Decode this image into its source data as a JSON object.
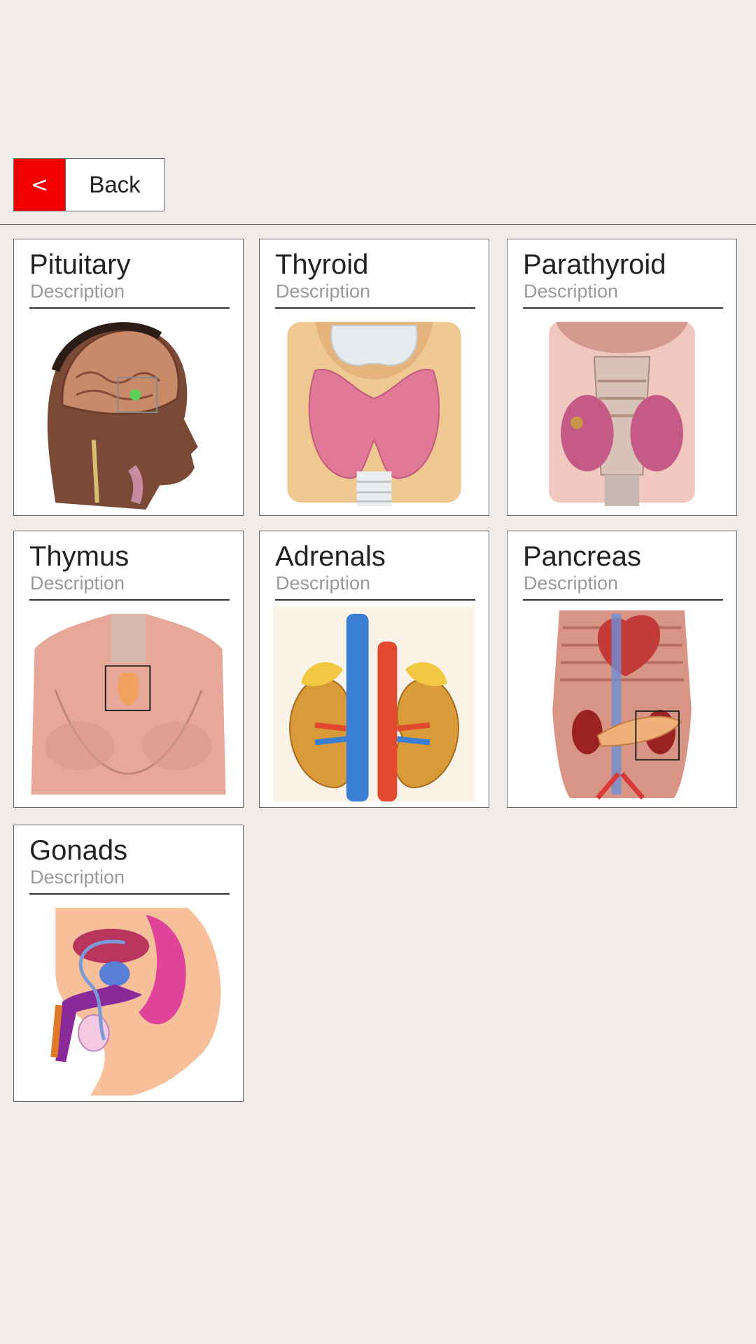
{
  "back_button": {
    "chevron": "<",
    "label": "Back"
  },
  "glands": [
    {
      "title": "Pituitary",
      "description": "Description",
      "image": "pituitary-head-illustration"
    },
    {
      "title": "Thyroid",
      "description": "Description",
      "image": "thyroid-illustration"
    },
    {
      "title": "Parathyroid",
      "description": "Description",
      "image": "parathyroid-illustration"
    },
    {
      "title": "Thymus",
      "description": "Description",
      "image": "thymus-chest-illustration"
    },
    {
      "title": "Adrenals",
      "description": "Description",
      "image": "adrenal-kidneys-illustration"
    },
    {
      "title": "Pancreas",
      "description": "Description",
      "image": "pancreas-torso-illustration"
    },
    {
      "title": "Gonads",
      "description": "Description",
      "image": "gonads-pelvis-illustration"
    }
  ],
  "colors": {
    "accent": "#f40000",
    "background": "#f1ece9"
  }
}
